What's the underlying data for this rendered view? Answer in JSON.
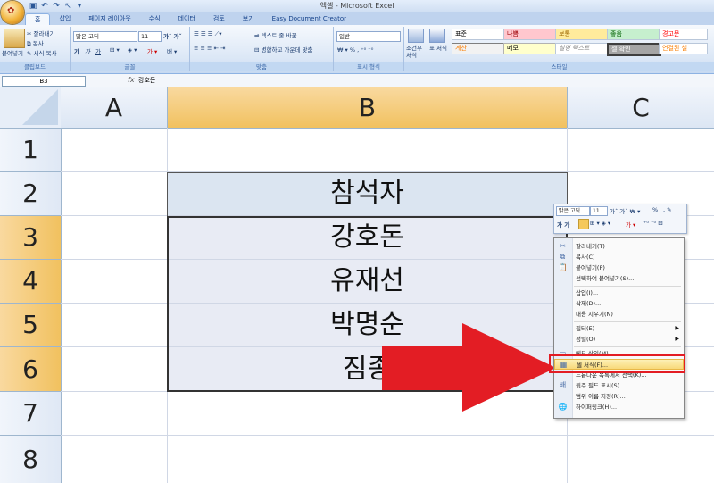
{
  "window": {
    "title": "엑셀 - Microsoft Excel"
  },
  "quick_access": [
    "save-icon",
    "undo-icon",
    "redo-icon",
    "pointer-icon",
    "customize-icon"
  ],
  "tabs": [
    "홈",
    "삽입",
    "페이지 레이아웃",
    "수식",
    "데이터",
    "검토",
    "보기",
    "Easy Document Creator"
  ],
  "ribbon": {
    "clipboard": {
      "paste": "붙여넣기",
      "cut": "잘라내기",
      "copy": "복사",
      "format_painter": "서식 복사",
      "label": "클립보드"
    },
    "font": {
      "name": "맑은 고딕",
      "size": "11",
      "label": "글꼴"
    },
    "alignment": {
      "wrap": "텍스트 줄 바꿈",
      "merge": "병합하고 가운데 맞춤",
      "label": "맞춤"
    },
    "number": {
      "format": "일반",
      "label": "표시 형식"
    },
    "styles": {
      "cond_format": "조건부 서식",
      "table_format": "표 서식",
      "cells": [
        "표준",
        "나쁨",
        "보통",
        "좋음",
        "경고문",
        "계산",
        "메모",
        "설명 텍스트",
        "셀 확인",
        "연결된 셀"
      ],
      "label": "스타일"
    }
  },
  "formula_bar": {
    "name_box": "B3",
    "fx": "fx",
    "content": "강호돈"
  },
  "columns": [
    "A",
    "B",
    "C"
  ],
  "rows": [
    "1",
    "2",
    "3",
    "4",
    "5",
    "6",
    "7",
    "8"
  ],
  "cells": {
    "b2": "참석자",
    "b3": "강호돈",
    "b4": "유재선",
    "b5": "박명순",
    "b6": "짐종"
  },
  "mini_toolbar": {
    "font": "맑은 고딕",
    "size": "11",
    "percent": "%"
  },
  "context_menu": {
    "items": [
      "잘라내기(T)",
      "복사(C)",
      "붙여넣기(P)",
      "선택하여 붙여넣기(S)...",
      "삽입(I)...",
      "삭제(D)...",
      "내용 지우기(N)",
      "필터(E)",
      "정렬(O)",
      "메모 삽입(M)",
      "셀 서식(F)...",
      "드롭다운 목록에서 선택(K)...",
      "윗주 필드 표시(S)",
      "범위 이름 지정(R)...",
      "하이퍼링크(H)..."
    ],
    "highlighted": "셀 서식(F)..."
  },
  "colors": {
    "selection": "#f1c15f",
    "highlight_box": "#e31d24",
    "arrow": "#e31d24"
  }
}
